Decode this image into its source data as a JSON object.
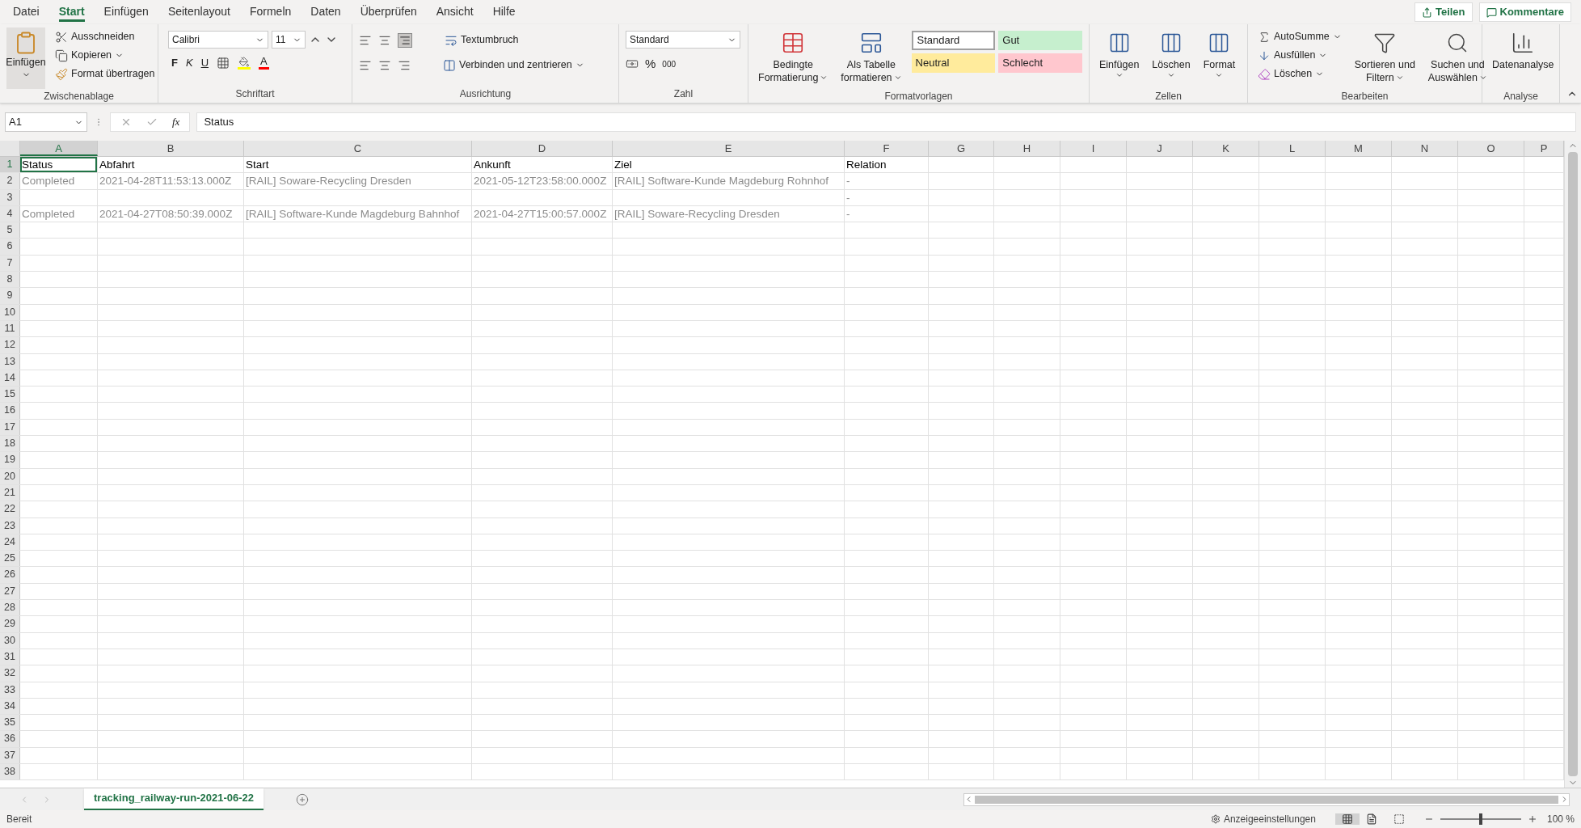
{
  "menu_tabs": [
    {
      "label": "Datei",
      "selected": false
    },
    {
      "label": "Start",
      "selected": true
    },
    {
      "label": "Einfügen",
      "selected": false
    },
    {
      "label": "Seitenlayout",
      "selected": false
    },
    {
      "label": "Formeln",
      "selected": false
    },
    {
      "label": "Daten",
      "selected": false
    },
    {
      "label": "Überprüfen",
      "selected": false
    },
    {
      "label": "Ansicht",
      "selected": false
    },
    {
      "label": "Hilfe",
      "selected": false
    }
  ],
  "share_buttons": {
    "share": "Teilen",
    "comments": "Kommentare"
  },
  "ribbon": {
    "clipboard": {
      "title": "Zwischenablage",
      "paste": "Einfügen",
      "cut": "Ausschneiden",
      "copy": "Kopieren",
      "format_painter": "Format übertragen"
    },
    "font": {
      "title": "Schriftart",
      "family": "Calibri",
      "size": "11",
      "bold": "F",
      "italic": "K",
      "underline": "U",
      "font_color": "A"
    },
    "alignment": {
      "title": "Ausrichtung",
      "wrap": "Textumbruch",
      "merge": "Verbinden und zentrieren"
    },
    "number": {
      "title": "Zahl",
      "format": "Standard",
      "percent": "%",
      "thousands": "000"
    },
    "styles": {
      "title": "Formatvorlagen",
      "conditional": [
        "Bedingte",
        "Formatierung"
      ],
      "as_table": [
        "Als Tabelle",
        "formatieren"
      ],
      "cell_styles": [
        {
          "label": "Standard",
          "color": "#ffffff"
        },
        {
          "label": "Gut",
          "color": "#c6efce"
        },
        {
          "label": "Neutral",
          "color": "#ffeb9c"
        },
        {
          "label": "Schlecht",
          "color": "#ffc7ce"
        }
      ]
    },
    "cells": {
      "title": "Zellen",
      "buttons": [
        "Einfügen",
        "Löschen",
        "Format"
      ]
    },
    "editing": {
      "title": "Bearbeiten",
      "autosum": "AutoSumme",
      "fill": "Ausfüllen",
      "clear": "Löschen",
      "sort": [
        "Sortieren und",
        "Filtern"
      ],
      "find": [
        "Suchen und",
        "Auswählen"
      ]
    },
    "analysis": {
      "title": "Analyse",
      "data_analysis": "Datenanalyse"
    }
  },
  "name_box": "A1",
  "function_label": "fx",
  "formula": "Status",
  "columns": [
    {
      "label": "A",
      "selected": true
    },
    {
      "label": "B",
      "selected": false
    },
    {
      "label": "C",
      "selected": false
    },
    {
      "label": "D",
      "selected": false
    },
    {
      "label": "E",
      "selected": false
    },
    {
      "label": "F",
      "selected": false
    },
    {
      "label": "G",
      "selected": false
    },
    {
      "label": "H",
      "selected": false
    },
    {
      "label": "I",
      "selected": false
    },
    {
      "label": "J",
      "selected": false
    },
    {
      "label": "K",
      "selected": false
    },
    {
      "label": "L",
      "selected": false
    },
    {
      "label": "M",
      "selected": false
    },
    {
      "label": "N",
      "selected": false
    },
    {
      "label": "O",
      "selected": false
    },
    {
      "label": "P",
      "selected": false
    }
  ],
  "rows": [
    {
      "number": "1",
      "selected": true,
      "obscured": false,
      "cells": [
        "Status",
        "Abfahrt",
        "Start",
        "Ankunft",
        "Ziel",
        "Relation"
      ]
    },
    {
      "number": "2",
      "selected": false,
      "obscured": true,
      "cells": [
        "Completed",
        "2021-04-28T11:53:13.000Z",
        "[RAIL] Soware-Recycling Dresden",
        "2021-05-12T23:58:00.000Z",
        "[RAIL] Software-Kunde Magdeburg Rohnhof",
        "-"
      ]
    },
    {
      "number": "3",
      "selected": false,
      "obscured": true,
      "cells": [
        "",
        "",
        "",
        "",
        "",
        "-"
      ]
    },
    {
      "number": "4",
      "selected": false,
      "obscured": true,
      "cells": [
        "Completed",
        "2021-04-27T08:50:39.000Z",
        "[RAIL] Software-Kunde Magdeburg Bahnhof",
        "2021-04-27T15:00:57.000Z",
        "[RAIL] Soware-Recycling Dresden",
        "-"
      ]
    },
    {
      "number": "5"
    },
    {
      "number": "6"
    },
    {
      "number": "7"
    },
    {
      "number": "8"
    },
    {
      "number": "9"
    },
    {
      "number": "10"
    },
    {
      "number": "11"
    },
    {
      "number": "12"
    },
    {
      "number": "13"
    },
    {
      "number": "14"
    },
    {
      "number": "15"
    },
    {
      "number": "16"
    },
    {
      "number": "17"
    },
    {
      "number": "18"
    },
    {
      "number": "19"
    },
    {
      "number": "20"
    },
    {
      "number": "21"
    },
    {
      "number": "22"
    },
    {
      "number": "23"
    },
    {
      "number": "24"
    },
    {
      "number": "25"
    },
    {
      "number": "26"
    },
    {
      "number": "27"
    },
    {
      "number": "28"
    },
    {
      "number": "29"
    },
    {
      "number": "30"
    },
    {
      "number": "31"
    },
    {
      "number": "32"
    },
    {
      "number": "33"
    },
    {
      "number": "34"
    },
    {
      "number": "35"
    },
    {
      "number": "36"
    },
    {
      "number": "37"
    },
    {
      "number": "38"
    }
  ],
  "sheet_tabs": [
    {
      "label": "tracking_railway-run-2021-06-22",
      "selected": true
    }
  ],
  "status_bar": {
    "mode": "Bereit",
    "display_settings": "Anzeigeeinstellungen",
    "zoom_slider": {
      "level": 0.5
    },
    "zoom": "100 %"
  }
}
